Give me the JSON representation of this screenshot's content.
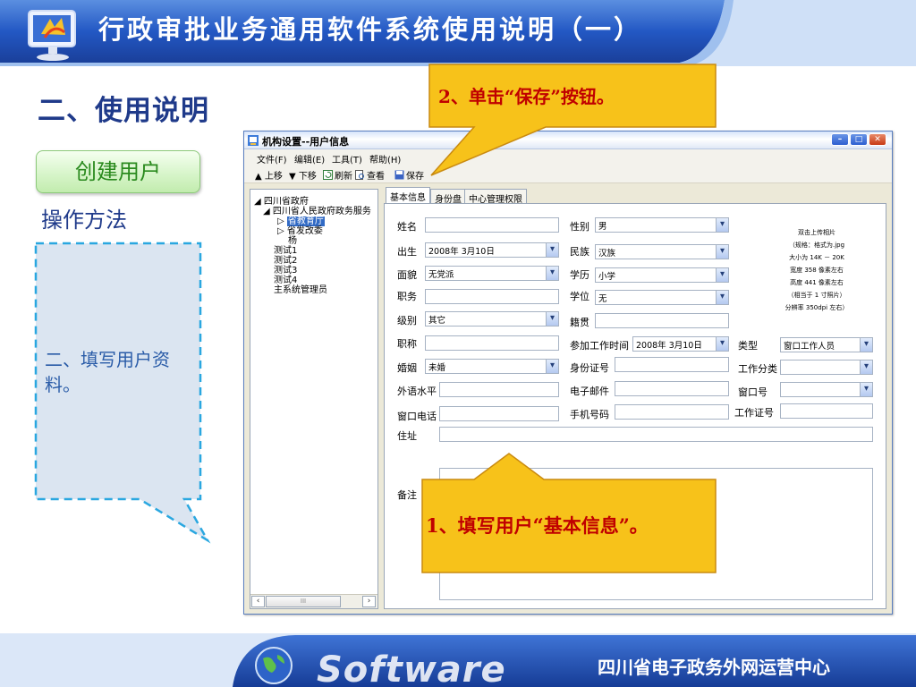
{
  "banner": {
    "title": "行政审批业务通用软件系统使用说明（一）"
  },
  "section_title": "二、使用说明",
  "create_user_button": "创建用户",
  "method_label": "操作方法",
  "side_callout_text": "二、填写用户资料。",
  "callout_save": "2、单击“保存”按钮。",
  "callout_fill": "1、填写用户“基本信息”。",
  "window": {
    "title": "机构设置--用户信息",
    "menu": [
      "文件(F)",
      "编辑(E)",
      "工具(T)",
      "帮助(H)"
    ],
    "toolbar": {
      "up": "上移",
      "down": "下移",
      "refresh": "刷新",
      "view": "查看",
      "save": "保存"
    },
    "tree": [
      "四川省政府",
      "四川省人民政府政务服务",
      "省教育厅",
      "省发改委",
      "杨",
      "测试1",
      "测试2",
      "测试3",
      "测试4",
      "主系统管理员"
    ],
    "tabs": [
      "基本信息",
      "身份盘",
      "中心管理权限"
    ],
    "form": {
      "name_label": "姓名",
      "name_value": "",
      "gender_label": "性别",
      "gender_value": "男",
      "birth_label": "出生",
      "birth_value": "2008年 3月10日",
      "ethnic_label": "民族",
      "ethnic_value": "汉族",
      "political_label": "面貌",
      "political_value": "无党派",
      "education_label": "学历",
      "education_value": "小学",
      "position_label": "职务",
      "position_value": "",
      "degree_label": "学位",
      "degree_value": "无",
      "rank_label": "级别",
      "rank_value": "其它",
      "native_label": "籍贯",
      "native_value": "",
      "title_label": "职称",
      "title_value": "",
      "work_start_label": "参加工作时间",
      "work_start_value": "2008年 3月10日",
      "type_label": "类型",
      "type_value": "窗口工作人员",
      "marriage_label": "婚姻",
      "marriage_value": "未婚",
      "id_label": "身份证号",
      "id_value": "",
      "work_class_label": "工作分类",
      "work_class_value": "",
      "language_label": "外语水平",
      "language_value": "",
      "email_label": "电子邮件",
      "email_value": "",
      "window_no_label": "窗口号",
      "window_no_value": "",
      "window_phone_label": "窗口电话",
      "window_phone_value": "",
      "mobile_label": "手机号码",
      "mobile_value": "",
      "work_id_label": "工作证号",
      "work_id_value": "",
      "address_label": "住址",
      "address_value": "",
      "remark_label": "备注",
      "remark_value": ""
    },
    "photo_hint": [
      "双击上传相片",
      "（规格：格式为.jpg",
      "大小为 14K － 20K",
      "宽度 358 像素左右",
      "高度 441 像素左右",
      "（相当于 1 寸照片）",
      "分辨率 350dpi 左右）"
    ]
  },
  "footer": {
    "brand_text": "Software",
    "org_name": "四川省电子政务外网运营中心"
  },
  "colors": {
    "banner_blue": "#1f55b8",
    "callout_fill": "#f7c21a",
    "callout_text": "#c00000",
    "heading_blue": "#1f3a8a",
    "green_button": "#2a8a1e"
  }
}
